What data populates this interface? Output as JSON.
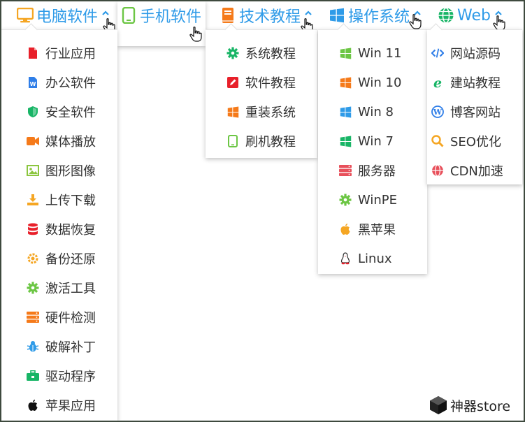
{
  "nav": [
    {
      "label": "电脑软件",
      "icon": "monitor-icon"
    },
    {
      "label": "手机软件",
      "icon": "phone-icon"
    },
    {
      "label": "技术教程",
      "icon": "book-icon"
    },
    {
      "label": "操作系统",
      "icon": "windows-icon"
    },
    {
      "label": "Web",
      "icon": "globe-icon"
    }
  ],
  "menus": {
    "pc": [
      {
        "label": "行业应用",
        "icon": "pdf-file-icon",
        "color": "#e8202a"
      },
      {
        "label": "办公软件",
        "icon": "word-file-icon",
        "color": "#2f7ee8"
      },
      {
        "label": "安全软件",
        "icon": "shield-icon",
        "color": "#18b566"
      },
      {
        "label": "媒体播放",
        "icon": "video-camera-icon",
        "color": "#f57a1a"
      },
      {
        "label": "图形图像",
        "icon": "image-icon",
        "color": "#8cc63f"
      },
      {
        "label": "上传下载",
        "icon": "download-icon",
        "color": "#f5a623"
      },
      {
        "label": "数据恢复",
        "icon": "database-icon",
        "color": "#e8202a"
      },
      {
        "label": "备份还原",
        "icon": "cog-sync-icon",
        "color": "#f5a623"
      },
      {
        "label": "激活工具",
        "icon": "gear-icon",
        "color": "#6cc644"
      },
      {
        "label": "硬件检测",
        "icon": "server-icon",
        "color": "#f57a1a"
      },
      {
        "label": "破解补丁",
        "icon": "bug-icon",
        "color": "#2f9be8"
      },
      {
        "label": "驱动程序",
        "icon": "toolbox-icon",
        "color": "#18b566"
      },
      {
        "label": "苹果应用",
        "icon": "apple-icon",
        "color": "#111111"
      }
    ],
    "tech": [
      {
        "label": "系统教程",
        "icon": "gear-icon",
        "color": "#18b566"
      },
      {
        "label": "软件教程",
        "icon": "edit-icon",
        "color": "#e8202a"
      },
      {
        "label": "重装系统",
        "icon": "windows-icon",
        "color": "#f57a1a"
      },
      {
        "label": "刷机教程",
        "icon": "phone-icon",
        "color": "#6cc644"
      }
    ],
    "os": [
      {
        "label": "Win 11",
        "icon": "windows-icon",
        "color": "#6cc644"
      },
      {
        "label": "Win 10",
        "icon": "windows-icon",
        "color": "#f57a1a"
      },
      {
        "label": "Win 8",
        "icon": "windows-icon",
        "color": "#2f9be8"
      },
      {
        "label": "Win 7",
        "icon": "windows-icon",
        "color": "#18b566"
      },
      {
        "label": "服务器",
        "icon": "server-icon",
        "color": "#e8505b"
      },
      {
        "label": "WinPE",
        "icon": "gear-icon",
        "color": "#6cc644"
      },
      {
        "label": "黑苹果",
        "icon": "apple-icon",
        "color": "#f5a623"
      },
      {
        "label": "Linux",
        "icon": "linux-penguin-icon",
        "color": "#e8202a"
      }
    ],
    "web": [
      {
        "label": "网站源码",
        "icon": "code-icon",
        "color": "#2f7ee8"
      },
      {
        "label": "建站教程",
        "icon": "ie-icon",
        "color": "#18b566"
      },
      {
        "label": "博客网站",
        "icon": "wordpress-icon",
        "color": "#2f7ee8"
      },
      {
        "label": "SEO优化",
        "icon": "search-icon",
        "color": "#f5a623"
      },
      {
        "label": "CDN加速",
        "icon": "globe-icon",
        "color": "#e8505b"
      }
    ]
  },
  "colors": {
    "nav_text": "#2f9be8",
    "monitor": "#f5a623",
    "phone": "#6cc644",
    "book": "#f57a1a",
    "windows": "#2f9be8",
    "globe": "#18b566"
  },
  "watermark": "神器store"
}
